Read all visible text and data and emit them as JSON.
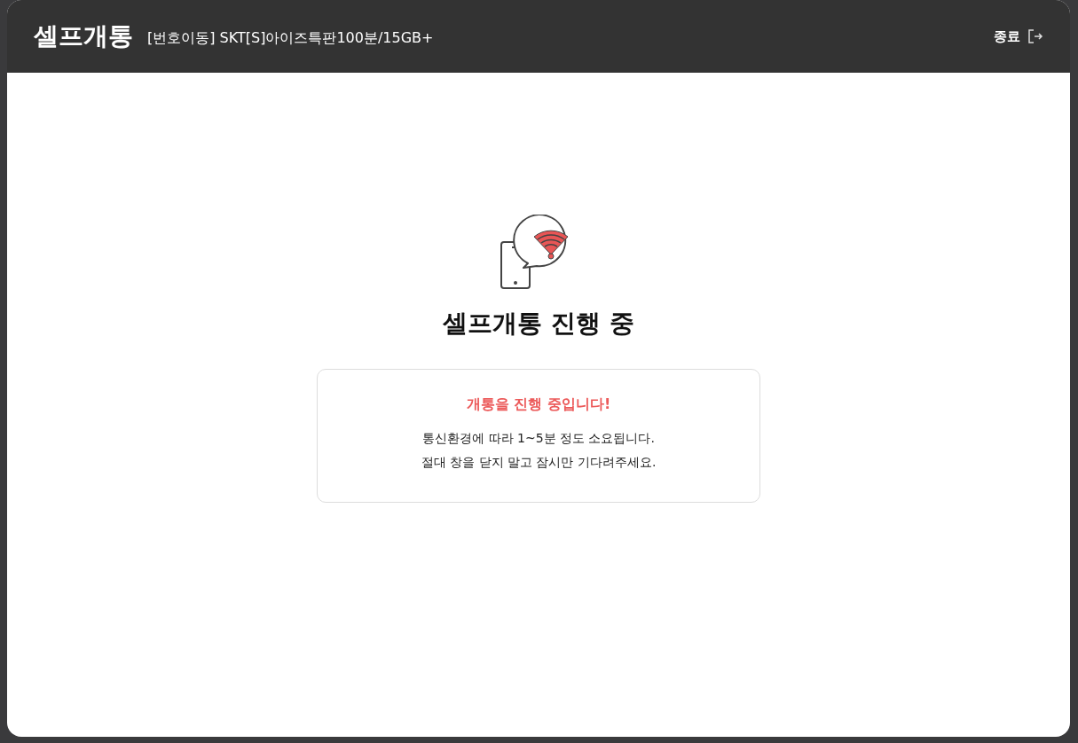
{
  "header": {
    "title": "셀프개통",
    "subtitle": "[번호이동] SKT[S]아이즈특판100분/15GB+",
    "exit_label": "종료"
  },
  "status": {
    "heading": "셀프개통 진행 중",
    "notice": {
      "title": "개통을 진행 중입니다!",
      "lines": [
        "통신환경에 따라 1~5분 정도 소요됩니다.",
        "절대 창을 닫지 말고 잠시만 기다려주세요."
      ]
    }
  }
}
